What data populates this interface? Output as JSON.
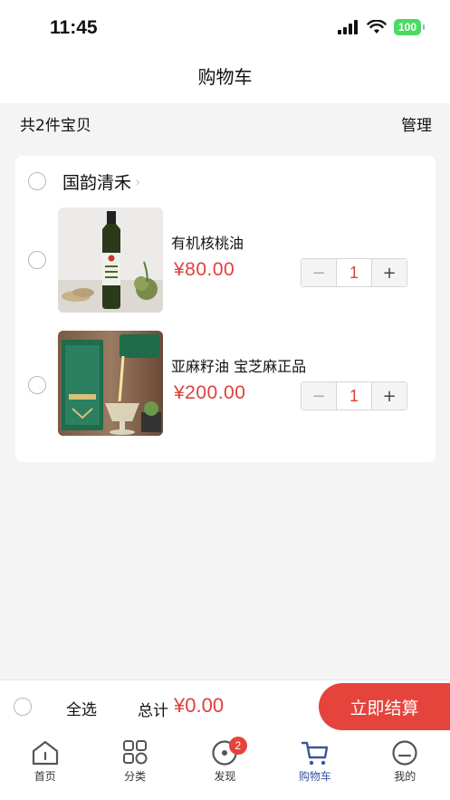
{
  "status": {
    "time": "11:45",
    "battery": "100"
  },
  "nav": {
    "title": "购物车"
  },
  "summary": {
    "count_text": "共2件宝贝",
    "manage_label": "管理"
  },
  "shop": {
    "name": "国韵清禾",
    "items": [
      {
        "title": "有机核桃油",
        "price": "¥80.00",
        "quantity": "1",
        "minus": "−",
        "plus": "+"
      },
      {
        "title": "亚麻籽油 宝芝麻正品",
        "price": "¥200.00",
        "quantity": "1",
        "minus": "−",
        "plus": "+"
      }
    ]
  },
  "checkout": {
    "select_all": "全选",
    "total_label": "总计",
    "total_value": "¥0.00",
    "button": "立即结算"
  },
  "tabs": [
    {
      "label": "首页",
      "icon": "home-icon"
    },
    {
      "label": "分类",
      "icon": "category-grid-icon"
    },
    {
      "label": "发现",
      "icon": "discover-icon",
      "badge": "2"
    },
    {
      "label": "购物车",
      "icon": "cart-icon",
      "active": true
    },
    {
      "label": "我的",
      "icon": "profile-icon"
    }
  ],
  "colors": {
    "accent": "#e5443d",
    "price": "#e0403a",
    "active_tab": "#3a55a0",
    "battery": "#4cd964"
  }
}
